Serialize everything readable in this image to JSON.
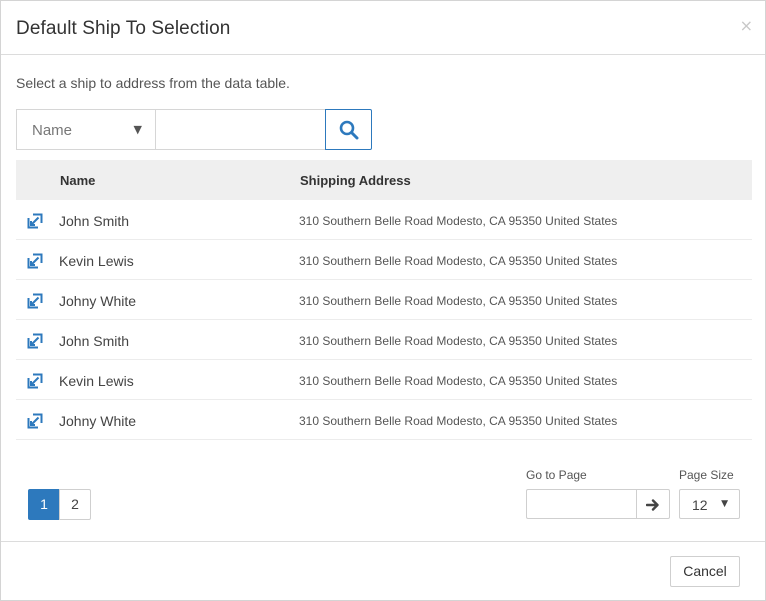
{
  "modal": {
    "title": "Default Ship To Selection",
    "close_glyph": "×"
  },
  "instruction": "Select a ship to address from the data table.",
  "search": {
    "field_selected": "Name",
    "input_value": "",
    "button_icon": "search-icon"
  },
  "table": {
    "columns": [
      "Name",
      "Shipping Address"
    ],
    "rows": [
      {
        "name": "John Smith",
        "address": "310 Southern Belle Road Modesto, CA 95350 United States"
      },
      {
        "name": "Kevin Lewis",
        "address": "310 Southern Belle Road Modesto, CA 95350 United States"
      },
      {
        "name": "Johny White",
        "address": "310 Southern Belle Road Modesto, CA 95350 United States"
      },
      {
        "name": "John Smith",
        "address": "310 Southern Belle Road Modesto, CA 95350 United States"
      },
      {
        "name": "Kevin Lewis",
        "address": "310 Southern Belle Road Modesto, CA 95350 United States"
      },
      {
        "name": "Johny White",
        "address": "310 Southern Belle Road Modesto, CA 95350 United States"
      }
    ],
    "row_icon": "select-arrow-icon"
  },
  "pagination": {
    "pages": [
      "1",
      "2"
    ],
    "current": "1"
  },
  "goto_page": {
    "label": "Go to Page",
    "value": "",
    "button_icon": "arrow-right-icon"
  },
  "page_size": {
    "label": "Page Size",
    "value": "12"
  },
  "footer": {
    "cancel_label": "Cancel"
  },
  "colors": {
    "accent": "#2d79bd",
    "header_bg": "#efefef"
  }
}
